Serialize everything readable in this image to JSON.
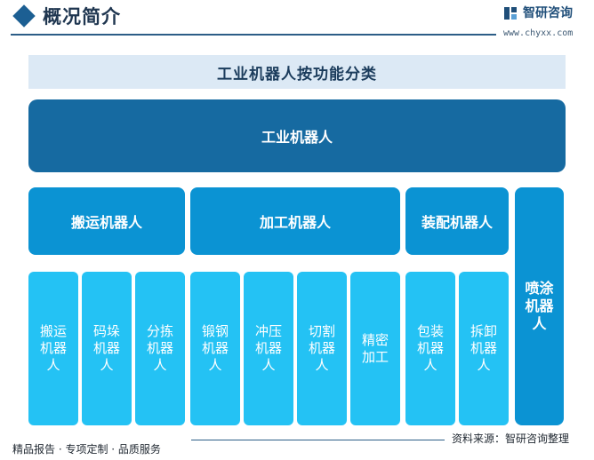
{
  "header": {
    "title": "概况简介",
    "brand_name": "智研咨询",
    "brand_url": "www.chyxx.com"
  },
  "diagram": {
    "title": "工业机器人按功能分类",
    "root": "工业机器人",
    "categories": [
      {
        "label": "搬运机器人",
        "children": [
          "搬运机器人",
          "码垛机器人",
          "分拣机器人"
        ]
      },
      {
        "label": "加工机器人",
        "children": [
          "锻钢机器人",
          "冲压机器人",
          "切割机器人",
          "精密加工"
        ]
      },
      {
        "label": "装配机器人",
        "children": [
          "包装机器人",
          "拆卸机器人"
        ]
      },
      {
        "label": "喷涂机器人",
        "children": []
      }
    ]
  },
  "footer": {
    "left": "精品报告 · 专项定制 · 品质服务",
    "source": "资料来源：智研咨询整理"
  },
  "colors": {
    "title_band": "#dce9f5",
    "root": "#166aa1",
    "category": "#0b93d3",
    "leaf": "#24c2f4",
    "header_accent": "#1c5f93"
  }
}
